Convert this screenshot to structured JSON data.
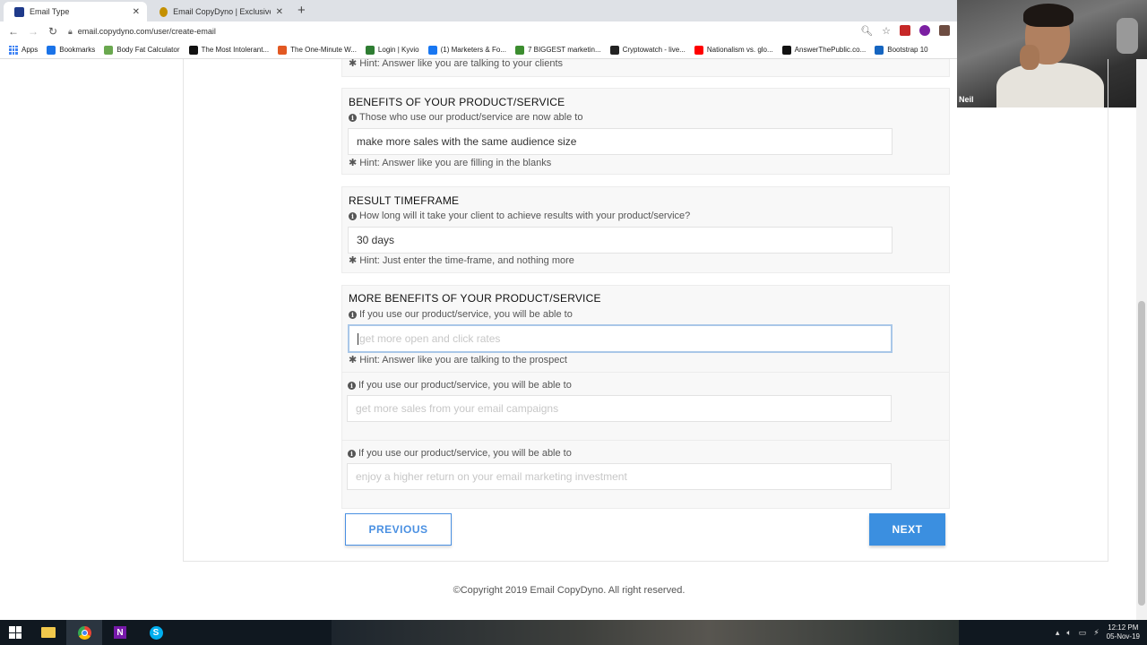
{
  "browser": {
    "tabs": [
      {
        "title": "Email Type",
        "active": true,
        "color": "#1f3a8a"
      },
      {
        "title": "Email CopyDyno | Exclusive Offe",
        "active": false,
        "color": "#c49000"
      }
    ],
    "url": "email.copydyno.com/user/create-email",
    "bookmarks": [
      {
        "label": "Apps",
        "color": "#4285f4"
      },
      {
        "label": "Bookmarks",
        "color": "#1a73e8"
      },
      {
        "label": "Body Fat Calculator",
        "color": "#6aa84f"
      },
      {
        "label": "The Most Intolerant...",
        "color": "#111111"
      },
      {
        "label": "The One-Minute W...",
        "color": "#e25822"
      },
      {
        "label": "Login | Kyvio",
        "color": "#2e7d32"
      },
      {
        "label": "(1) Marketers & Fo...",
        "color": "#1877f2"
      },
      {
        "label": "7 BIGGEST marketin...",
        "color": "#3c8d2f"
      },
      {
        "label": "Cryptowatch - live...",
        "color": "#222222"
      },
      {
        "label": "Nationalism vs. glo...",
        "color": "#ff0000"
      },
      {
        "label": "AnswerThePublic.co...",
        "color": "#111111"
      },
      {
        "label": "Bootstrap 10",
        "color": "#1565c0"
      }
    ]
  },
  "webcam": {
    "name": "Neil"
  },
  "sections": {
    "partial_hint": "Hint: Answer like you are talking to your clients",
    "benefits": {
      "title": "BENEFITS OF YOUR PRODUCT/SERVICE",
      "question": "Those who use our product/service are now able to",
      "value": "make more sales with the same audience size",
      "hint": "Hint: Answer like you are filling in the blanks"
    },
    "timeframe": {
      "title": "RESULT TIMEFRAME",
      "question": "How long will it take your client to achieve results with your product/service?",
      "value": "30 days",
      "hint": "Hint: Just enter the time-frame, and nothing more"
    },
    "more_benefits": {
      "title": "MORE BENEFITS OF YOUR PRODUCT/SERVICE",
      "items": [
        {
          "question": "If you use our product/service, you will be able to",
          "placeholder": "get more open and click rates",
          "hint": "Hint: Answer like you are talking to the prospect"
        },
        {
          "question": "If you use our product/service, you will be able to",
          "placeholder": "get more sales from your email campaigns"
        },
        {
          "question": "If you use our product/service, you will be able to",
          "placeholder": "enjoy a higher return on your email marketing investment"
        }
      ]
    }
  },
  "buttons": {
    "previous": "PREVIOUS",
    "next": "NEXT"
  },
  "footer": {
    "copyright": "©Copyright 2019 Email CopyDyno. All right reserved."
  },
  "taskbar": {
    "time": "12:12 PM",
    "date": "05-Nov-19"
  },
  "colors": {
    "accent": "#3b8fe0",
    "focus_border": "#a9c7e8"
  }
}
